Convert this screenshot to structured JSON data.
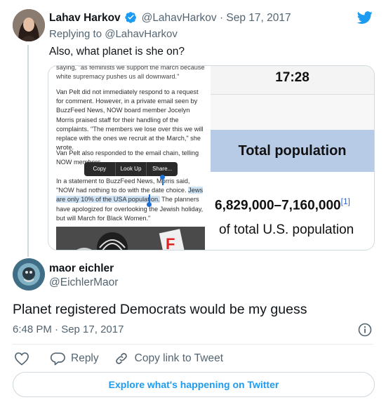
{
  "tweet1": {
    "display_name": "Lahav Harkov",
    "handle_date": "@LahavHarkov · Sep 17, 2017",
    "replying_to": "Replying to @LahavHarkov",
    "text": "Also, what planet is she on?",
    "media": {
      "article": {
        "line_top": "saying, \"as feminists we support the march because white supremacy pushes us all downward.\"",
        "para1": "Van Pelt did not immediately respond to a request for comment. However, in a private email seen by BuzzFeed News, NOW board member Jocelyn Morris praised staff for their handling of the complaints. \"The members we lose over this we will replace with the ones we recruit at the March,\" she wrote.",
        "para2": "Van Pelt also responded to the email chain, telling NOW members",
        "para3_a": "In a statement to BuzzFeed News, Morris said, \"NOW had nothing to do with the date choice. ",
        "para3_hl": "Jews are only 10% of the USA population.",
        "para3_b": " The planners have apologized for overlooking the Jewish holiday, but will March for Black Women.\"",
        "popup": [
          "Copy",
          "Look Up",
          "Share..."
        ]
      },
      "phone": {
        "time": "17:28",
        "header": "Total population",
        "range": "6,829,000–7,160,000",
        "ref": "[1]",
        "subtext": "of total U.S. population"
      }
    }
  },
  "tweet2": {
    "display_name": "maor eichler",
    "handle": "@EichlerMaor",
    "text": "Planet registered Democrats would be my guess",
    "timestamp": "6:48 PM · Sep 17, 2017"
  },
  "actions": {
    "reply": "Reply",
    "copy_link": "Copy link to Tweet"
  },
  "explore": "Explore what's happening on Twitter",
  "colors": {
    "accent": "#1d9bf0",
    "text": "#0f1419",
    "muted": "#536471"
  },
  "icons": [
    "twitter-bird-icon",
    "verified-badge-icon",
    "info-icon",
    "heart-icon",
    "reply-icon",
    "link-icon"
  ]
}
